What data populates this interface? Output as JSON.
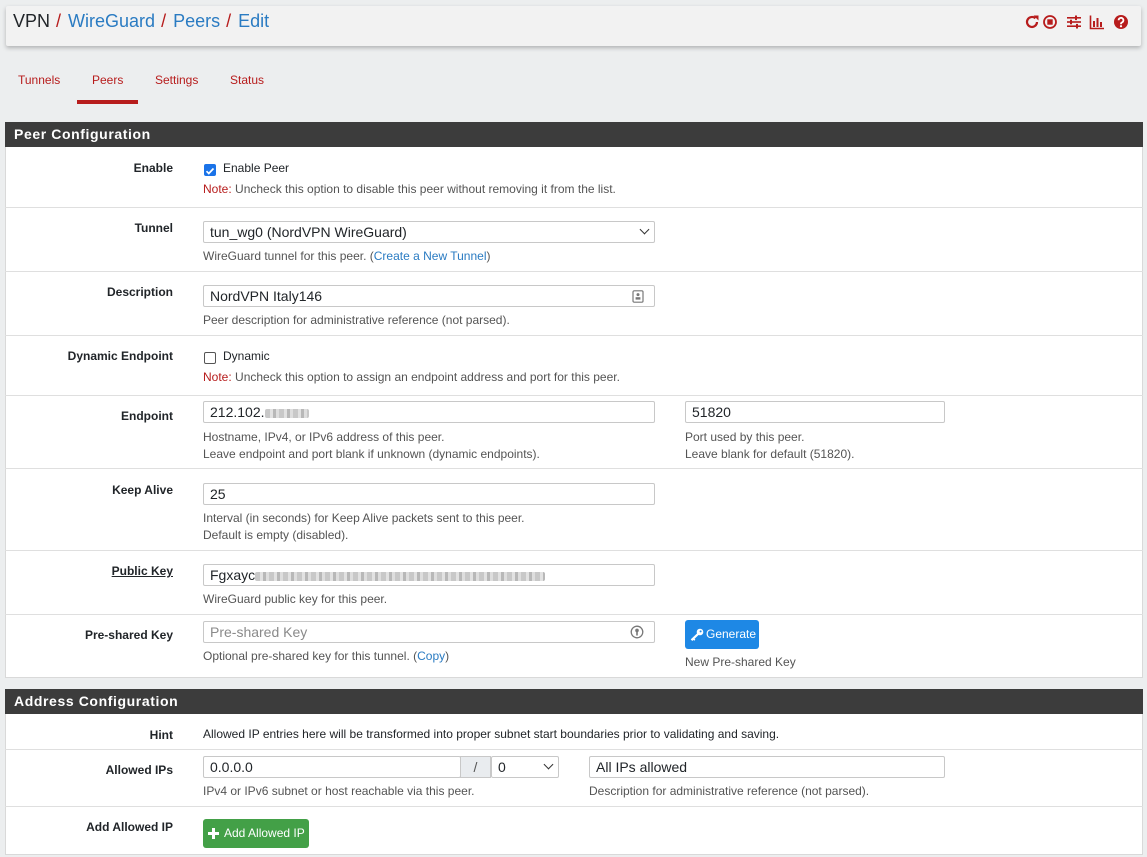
{
  "breadcrumb": {
    "root": "VPN",
    "items": [
      "WireGuard",
      "Peers",
      "Edit"
    ],
    "sep": "/"
  },
  "header_icons": [
    "reload-icon",
    "stop-icon",
    "sliders-icon",
    "chart-icon",
    "help-icon"
  ],
  "tabs": [
    {
      "label": "Tunnels",
      "active": false
    },
    {
      "label": "Peers",
      "active": true
    },
    {
      "label": "Settings",
      "active": false
    },
    {
      "label": "Status",
      "active": false
    }
  ],
  "peer_config": {
    "title": "Peer Configuration",
    "enable": {
      "label": "Enable",
      "checkbox_label": "Enable Peer",
      "checked": true,
      "note_prefix": "Note:",
      "note_text": " Uncheck this option to disable this peer without removing it from the list."
    },
    "tunnel": {
      "label": "Tunnel",
      "value": "tun_wg0 (NordVPN WireGuard)",
      "help_prefix": "WireGuard tunnel for this peer. (",
      "help_link": "Create a New Tunnel",
      "help_suffix": ")"
    },
    "description": {
      "label": "Description",
      "value": "NordVPN Italy146",
      "help": "Peer description for administrative reference (not parsed)."
    },
    "dynamic_endpoint": {
      "label": "Dynamic Endpoint",
      "checkbox_label": "Dynamic",
      "checked": false,
      "note_prefix": "Note:",
      "note_text": " Uncheck this option to assign an endpoint address and port for this peer."
    },
    "endpoint": {
      "label": "Endpoint",
      "value": "212.102.",
      "help1": "Hostname, IPv4, or IPv6 address of this peer.",
      "help2": "Leave endpoint and port blank if unknown (dynamic endpoints).",
      "port_value": "51820",
      "port_help1": "Port used by this peer.",
      "port_help2": "Leave blank for default (51820)."
    },
    "keep_alive": {
      "label": "Keep Alive",
      "value": "25",
      "help1": "Interval (in seconds) for Keep Alive packets sent to this peer.",
      "help2": "Default is empty (disabled)."
    },
    "public_key": {
      "label": "Public Key",
      "value": "Fgxayc",
      "help": "WireGuard public key for this peer."
    },
    "psk": {
      "label": "Pre-shared Key",
      "placeholder": "Pre-shared Key",
      "help_prefix": "Optional pre-shared key for this tunnel. (",
      "help_link": "Copy",
      "help_suffix": ")",
      "generate_label": "Generate",
      "generate_help": "New Pre-shared Key"
    }
  },
  "address_config": {
    "title": "Address Configuration",
    "hint": {
      "label": "Hint",
      "text": "Allowed IP entries here will be transformed into proper subnet start boundaries prior to validating and saving."
    },
    "allowed_ips": {
      "label": "Allowed IPs",
      "value": "0.0.0.0",
      "slash": "/",
      "mask": "0",
      "help": "IPv4 or IPv6 subnet or host reachable via this peer.",
      "desc_value": "All IPs allowed",
      "desc_help": "Description for administrative reference (not parsed)."
    },
    "add_allowed_ip": {
      "label": "Add Allowed IP",
      "button_label": "Add Allowed IP"
    }
  },
  "colors": {
    "accent_red": "#b71c1c",
    "link_blue": "#2a7bc2",
    "button_blue": "#1e88e5",
    "button_green": "#43a047",
    "panel_header": "#3c3c3c"
  }
}
